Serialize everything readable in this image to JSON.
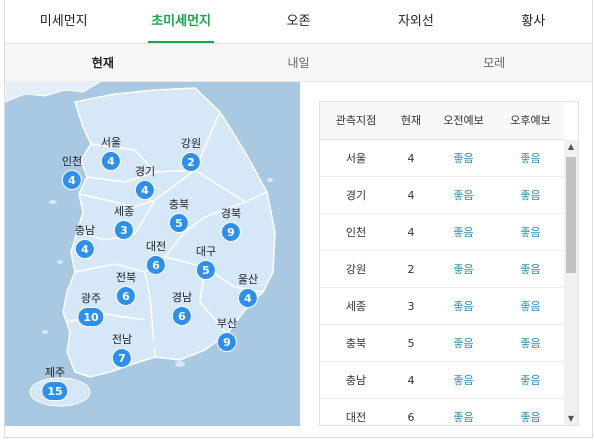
{
  "tabs": [
    "미세먼지",
    "초미세먼지",
    "오존",
    "자외선",
    "황사"
  ],
  "active_tab": 1,
  "days": [
    "현재",
    "내일",
    "모레"
  ],
  "active_day": 0,
  "colors": {
    "accent": "#17a64a",
    "badge": "#2d8ff0",
    "good": "#2f8fbf",
    "sea": "#a9c8e2",
    "land": "#d6e8f7"
  },
  "regions": [
    {
      "name": "서울",
      "value": "4"
    },
    {
      "name": "강원",
      "value": "2"
    },
    {
      "name": "인천",
      "value": "4"
    },
    {
      "name": "경기",
      "value": "4"
    },
    {
      "name": "세종",
      "value": "3"
    },
    {
      "name": "충북",
      "value": "5"
    },
    {
      "name": "경북",
      "value": "9"
    },
    {
      "name": "충남",
      "value": "4"
    },
    {
      "name": "대전",
      "value": "6"
    },
    {
      "name": "대구",
      "value": "5"
    },
    {
      "name": "전북",
      "value": "6"
    },
    {
      "name": "울산",
      "value": "4"
    },
    {
      "name": "광주",
      "value": "10"
    },
    {
      "name": "경남",
      "value": "6"
    },
    {
      "name": "부산",
      "value": "9"
    },
    {
      "name": "전남",
      "value": "7"
    },
    {
      "name": "제주",
      "value": "15"
    }
  ],
  "table": {
    "headers": [
      "관측지점",
      "현재",
      "오전예보",
      "오후예보"
    ],
    "rows": [
      [
        "서울",
        "4",
        "좋음",
        "좋음"
      ],
      [
        "경기",
        "4",
        "좋음",
        "좋음"
      ],
      [
        "인천",
        "4",
        "좋음",
        "좋음"
      ],
      [
        "강원",
        "2",
        "좋음",
        "좋음"
      ],
      [
        "세종",
        "3",
        "좋음",
        "좋음"
      ],
      [
        "충북",
        "5",
        "좋음",
        "좋음"
      ],
      [
        "충남",
        "4",
        "좋음",
        "좋음"
      ],
      [
        "대전",
        "6",
        "좋음",
        "좋음"
      ]
    ]
  },
  "scrollbar": {
    "up_icon": "▲",
    "down_icon": "▼"
  }
}
